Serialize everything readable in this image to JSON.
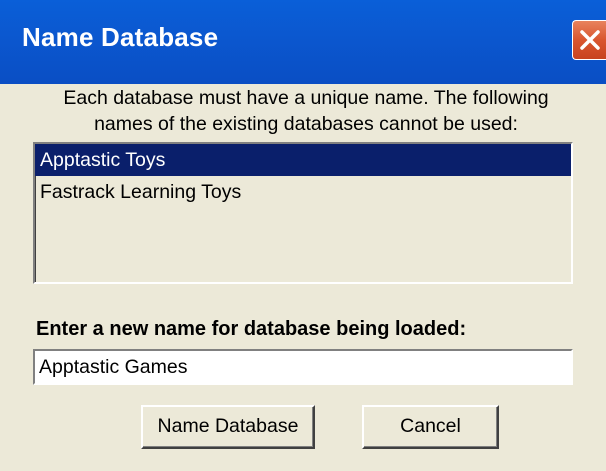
{
  "window": {
    "title": "Name Database",
    "close_icon": "close-icon"
  },
  "instructions": {
    "line1": "Each database must have a unique name. The following",
    "line2": "names of the existing databases cannot be used:"
  },
  "existing_databases": {
    "items": [
      {
        "label": "Apptastic Toys",
        "selected": true
      },
      {
        "label": "Fastrack Learning Toys",
        "selected": false
      }
    ]
  },
  "new_name": {
    "label": "Enter a new name for database being loaded:",
    "value": "Apptastic Games"
  },
  "buttons": {
    "confirm_label": "Name Database",
    "cancel_label": "Cancel"
  },
  "colors": {
    "titlebar": "#0a5fd8",
    "selection": "#0a1f6b",
    "dialog_bg": "#ece9d8",
    "close_button": "#d9562f"
  }
}
